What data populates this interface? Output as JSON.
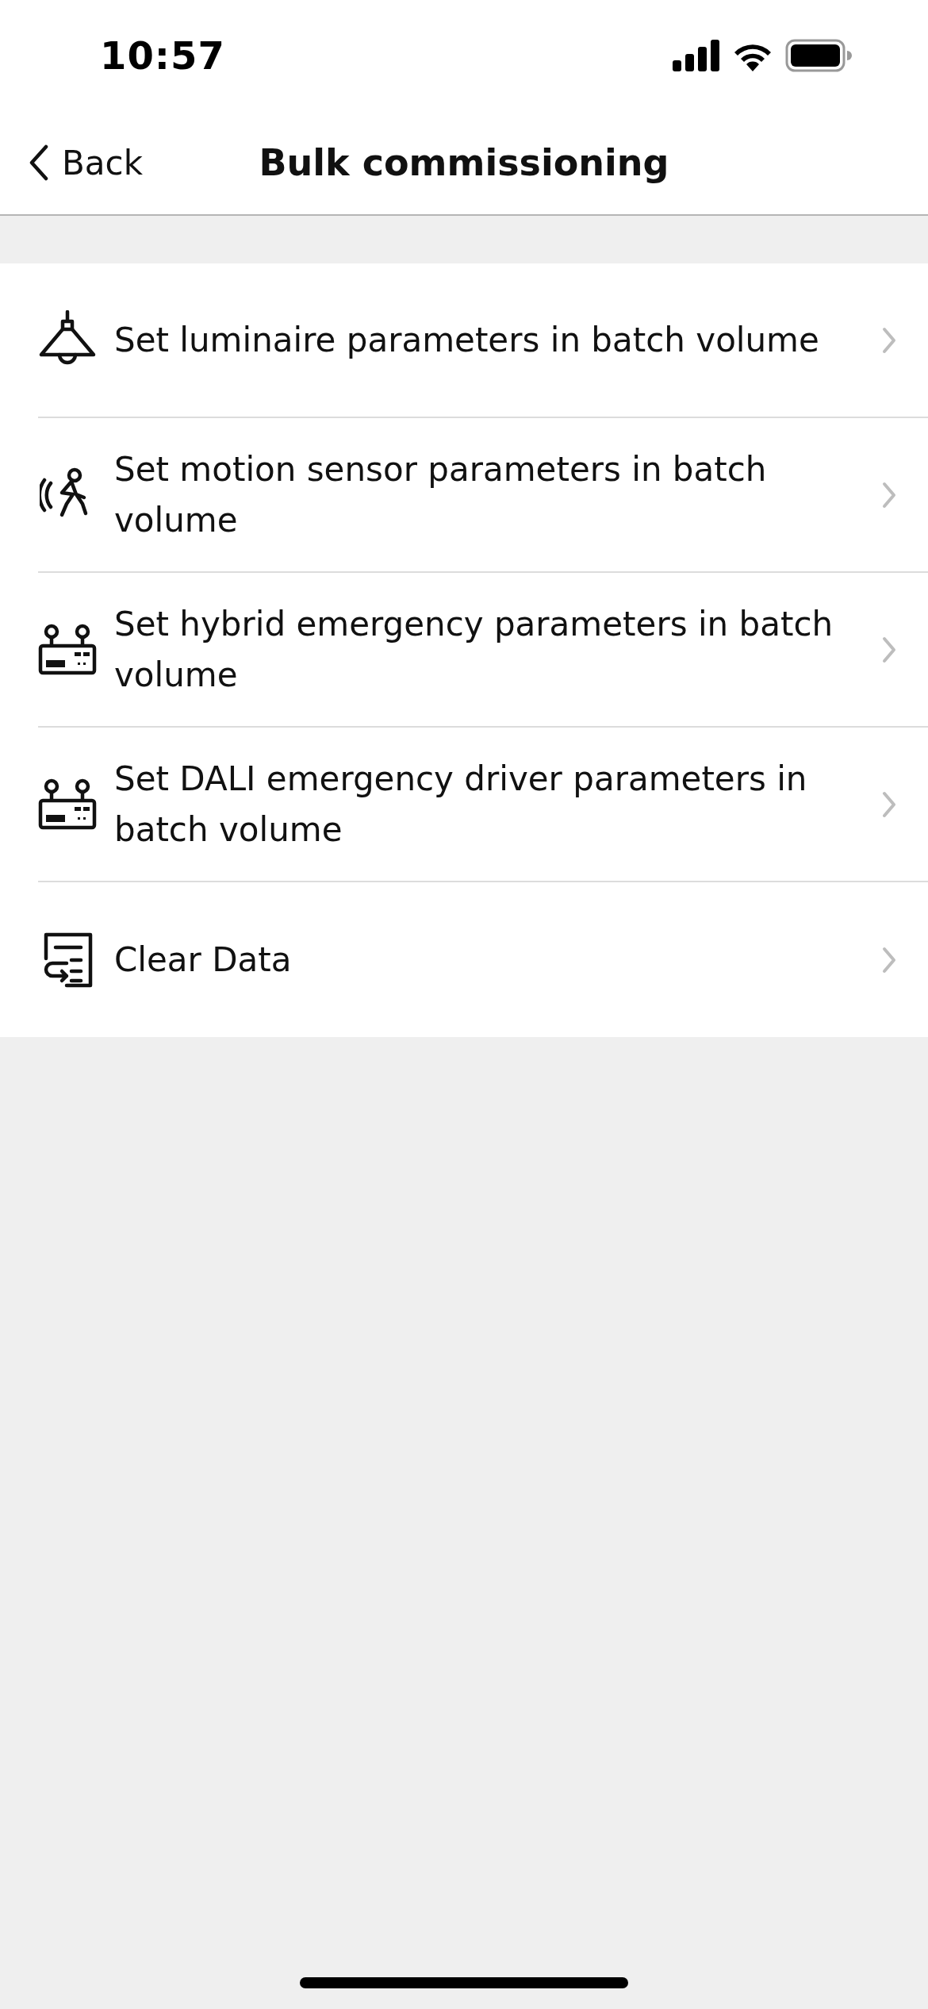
{
  "status_bar": {
    "time": "10:57"
  },
  "nav": {
    "back": "Back",
    "title": "Bulk commissioning"
  },
  "items": [
    {
      "kind": "lamp",
      "label": "Set luminaire parameters in batch volume"
    },
    {
      "kind": "motion",
      "label": "Set motion sensor parameters in batch volume"
    },
    {
      "kind": "device",
      "label": "Set hybrid emergency parameters in batch volume"
    },
    {
      "kind": "device",
      "label": "Set DALI emergency driver parameters in batch volume"
    },
    {
      "kind": "clear",
      "label": "Clear Data"
    }
  ]
}
